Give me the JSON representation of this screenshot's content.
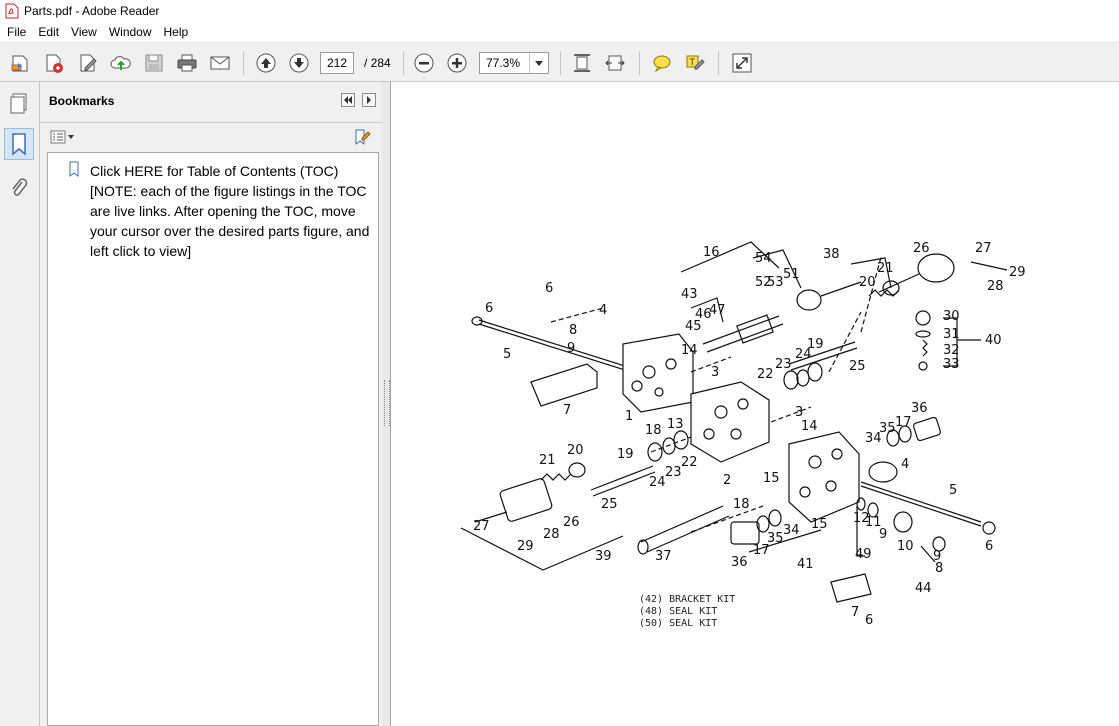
{
  "window": {
    "title": "Parts.pdf - Adobe Reader"
  },
  "menu": [
    "File",
    "Edit",
    "View",
    "Window",
    "Help"
  ],
  "toolbar": {
    "page_current": "212",
    "page_total": "/ 284",
    "zoom": "77.3%"
  },
  "bookmarks": {
    "title": "Bookmarks",
    "items": [
      {
        "label": "Click HERE for Table of Contents (TOC) [NOTE: each of the figure listings in the TOC are live links. After opening the TOC, move your cursor over the desired parts figure, and left click to view]"
      }
    ]
  },
  "figure": {
    "caption_lines": [
      "(42) BRACKET KIT",
      "(48) SEAL KIT",
      "(50) SEAL KIT"
    ],
    "callouts": [
      "1",
      "2",
      "3",
      "4",
      "5",
      "6",
      "7",
      "8",
      "9",
      "10",
      "11",
      "12",
      "13",
      "14",
      "15",
      "16",
      "17",
      "18",
      "19",
      "20",
      "21",
      "22",
      "23",
      "24",
      "25",
      "26",
      "27",
      "28",
      "29",
      "30",
      "31",
      "32",
      "33",
      "34",
      "35",
      "36",
      "37",
      "38",
      "39",
      "40",
      "41",
      "43",
      "44",
      "45",
      "46",
      "47",
      "49",
      "51",
      "52",
      "53",
      "54"
    ]
  },
  "icons": [
    "open-icon",
    "create-pdf-icon",
    "edit-icon",
    "cloud-upload-icon",
    "save-icon",
    "print-icon",
    "email-icon",
    "previous-page-icon",
    "next-page-icon",
    "zoom-out-icon",
    "zoom-in-icon",
    "fit-page-icon",
    "fit-width-icon",
    "comment-icon",
    "highlight-icon",
    "expand-icon",
    "page-thumbnails-icon",
    "bookmarks-icon",
    "attachments-icon"
  ]
}
